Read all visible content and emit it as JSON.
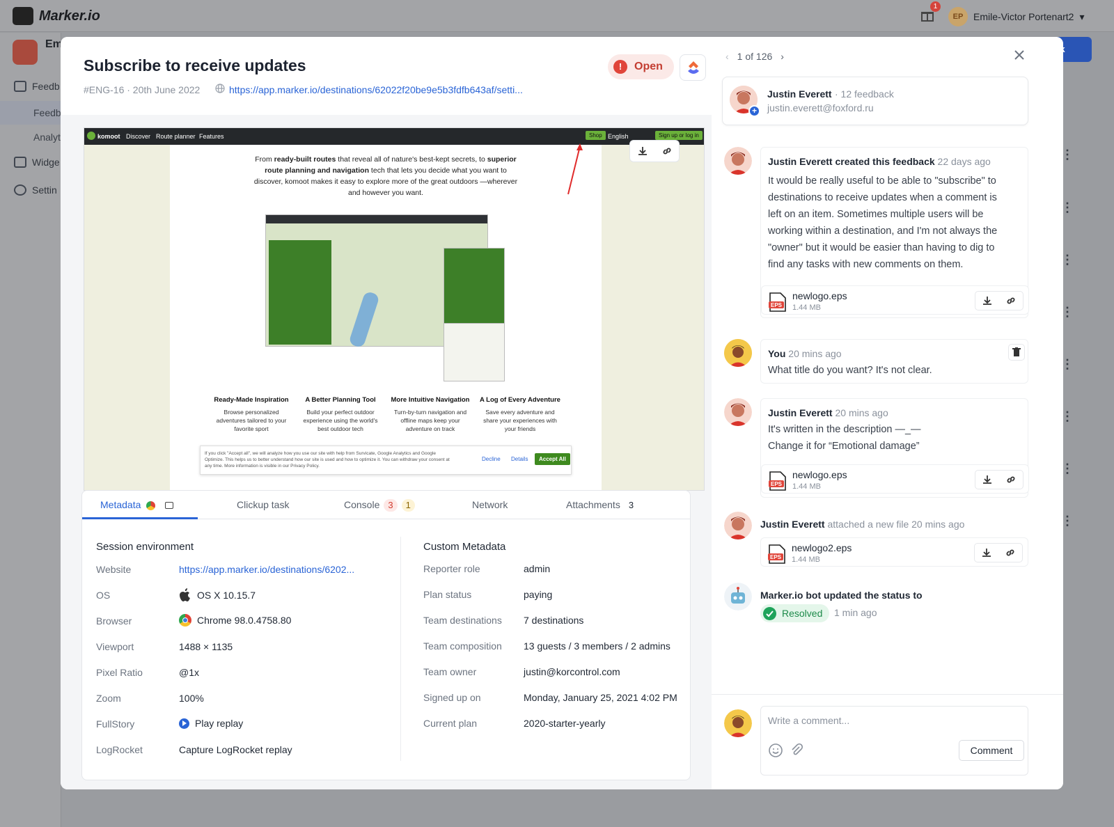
{
  "app": {
    "name": "Marker.io",
    "user_initials": "EP",
    "user_name": "Emile-Victor Portenart2",
    "notif_count": "1",
    "project_short": "Em",
    "back_btn": "back"
  },
  "bg_nav": [
    {
      "label": "Feedb"
    },
    {
      "label": "Feedb"
    },
    {
      "label": "Analyt"
    },
    {
      "label": "Widge"
    },
    {
      "label": "Settin"
    }
  ],
  "issue": {
    "title": "Subscribe to receive updates",
    "meta": "#ENG-16 · 20th June 2022",
    "url": "https://app.marker.io/destinations/62022f20be9e5b3fdfb643af/setti...",
    "status": "Open",
    "status_icon": "!"
  },
  "screenshot": {
    "brand": "komoot",
    "nav": [
      "Discover",
      "Route planner",
      "Features"
    ],
    "shop": "Shop",
    "lang": "English",
    "signup": "Sign up or log in",
    "features": [
      {
        "title": "Ready-Made Inspiration",
        "text": "Browse personalized adventures tailored to your favorite sport"
      },
      {
        "title": "A Better Planning Tool",
        "text": "Build your perfect outdoor experience using the world's best outdoor tech"
      },
      {
        "title": "More Intuitive Navigation",
        "text": "Turn-by-turn navigation and offline maps keep your adventure on track"
      },
      {
        "title": "A Log of Every Adventure",
        "text": "Save every adventure and share your experiences with your friends"
      }
    ],
    "cookie_text": "If you click \"Accept all\", we will analyze how you use our site with help from Survicate, Google Analytics and Google Optimize. This helps us to better understand how our site is used and how to optimize it. You can withdraw your consent at any time. More information is visible in our Privacy Policy.",
    "decline": "Decline",
    "details": "Details",
    "accept": "Accept All"
  },
  "tabs": [
    {
      "label": "Metadata"
    },
    {
      "label": "Clickup task"
    },
    {
      "label": "Console",
      "errors": "3",
      "warnings": "1"
    },
    {
      "label": "Network"
    },
    {
      "label": "Attachments",
      "count": "3"
    }
  ],
  "session": {
    "title": "Session environment",
    "rows": [
      {
        "k": "Website",
        "v": "https://app.marker.io/destinations/6202..."
      },
      {
        "k": "OS",
        "v": "OS X 10.15.7",
        "icon": "apple-icon"
      },
      {
        "k": "Browser",
        "v": "Chrome 98.0.4758.80",
        "icon": "chrome-icon"
      },
      {
        "k": "Viewport",
        "v": "1488 × 1135"
      },
      {
        "k": "Pixel Ratio",
        "v": "@1x"
      },
      {
        "k": "Zoom",
        "v": "100%"
      },
      {
        "k": "FullStory",
        "v": "Play replay",
        "icon": "play-icon"
      },
      {
        "k": "LogRocket",
        "v": "Capture LogRocket replay"
      }
    ]
  },
  "custom": {
    "title": "Custom Metadata",
    "rows": [
      {
        "k": "Reporter role",
        "v": "admin"
      },
      {
        "k": "Plan status",
        "v": "paying"
      },
      {
        "k": "Team destinations",
        "v": "7 destinations"
      },
      {
        "k": "Team composition",
        "v": "13 guests / 3 members / 2 admins"
      },
      {
        "k": "Team owner",
        "v": "justin@korcontrol.com"
      },
      {
        "k": "Signed up on",
        "v": "Monday, January 25, 2021 4:02 PM"
      },
      {
        "k": "Current plan",
        "v": "2020-starter-yearly"
      }
    ]
  },
  "sidebar": {
    "pager": "1 of 126",
    "reporter": {
      "name": "Justin Everett",
      "count": "· 12 feedback",
      "email": "justin.everett@foxford.ru"
    },
    "activity": [
      {
        "author": "Justin Everett",
        "action": "created this feedback",
        "time": "22 days ago",
        "lines": [
          "It would be really useful to be able to \"subscribe\" to",
          "destinations to receive updates when a comment is",
          "left on an item. Sometimes multiple users will be",
          "working within a destination, and I'm not always the",
          "\"owner\" but it would be easier than having to dig to",
          "find any tasks with new comments on them."
        ],
        "file": {
          "name": "newlogo.eps",
          "size": "1.44 MB"
        }
      },
      {
        "author": "You",
        "time": "20 mins ago",
        "text": "What title do you want? It's not clear."
      },
      {
        "author": "Justin Everett",
        "time": "20 mins ago",
        "line1": "It's written in the description —_—",
        "line2": "Change it for “Emotional damage”",
        "file": {
          "name": "newlogo.eps",
          "size": "1.44 MB"
        }
      },
      {
        "author": "Justin Everett",
        "action": "attached a new file 20 mins ago",
        "file": {
          "name": "newlogo2.eps",
          "size": "1.44 MB"
        }
      },
      {
        "author": "Marker.io bot",
        "action": "updated the status to",
        "status": "Resolved",
        "time": "1 min ago"
      }
    ],
    "composer": {
      "placeholder": "Write a comment...",
      "button": "Comment"
    }
  },
  "colors": {
    "accent": "#2a64d6",
    "open": "#e0453a",
    "resolved": "#1ea35a",
    "komoot_green": "#6bb13a"
  }
}
